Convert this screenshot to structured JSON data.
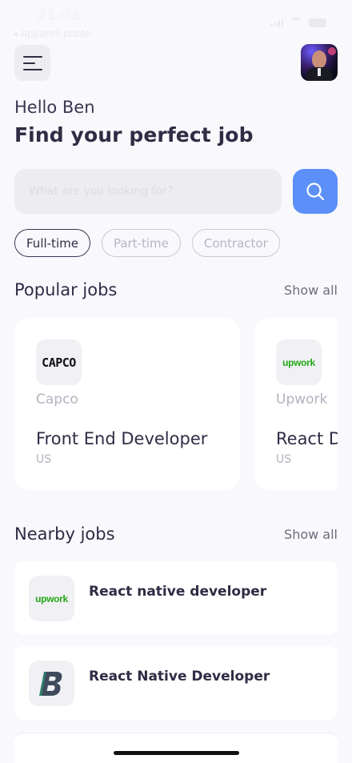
{
  "status_bar": {
    "time": "21:03",
    "back_label": "◂ Appareil photo"
  },
  "header": {
    "greeting": "Hello Ben",
    "headline": "Find your perfect job"
  },
  "search": {
    "placeholder": "What are you looking for?"
  },
  "filters": [
    {
      "label": "Full-time",
      "active": true
    },
    {
      "label": "Part-time",
      "active": false
    },
    {
      "label": "Contractor",
      "active": false
    }
  ],
  "popular": {
    "title": "Popular jobs",
    "show_all": "Show all",
    "jobs": [
      {
        "logo_text": "CAPCO",
        "company": "Capco",
        "title": "Front End Developer",
        "location": "US"
      },
      {
        "logo_text": "upwork",
        "company": "Upwork",
        "title": "React Developer",
        "location": "US"
      }
    ]
  },
  "nearby": {
    "title": "Nearby jobs",
    "show_all": "Show all",
    "jobs": [
      {
        "logo_text": "upwork",
        "title": "React native developer"
      },
      {
        "logo_text": "B",
        "title": "React Native Developer"
      }
    ]
  },
  "colors": {
    "background": "#f8f8fd",
    "accent": "#5c8ff7",
    "text_primary": "#2f2c44",
    "text_muted": "#b3b2bf",
    "upwork_green": "#23a816"
  },
  "icons": {
    "menu": "menu-icon",
    "search": "search-icon"
  }
}
